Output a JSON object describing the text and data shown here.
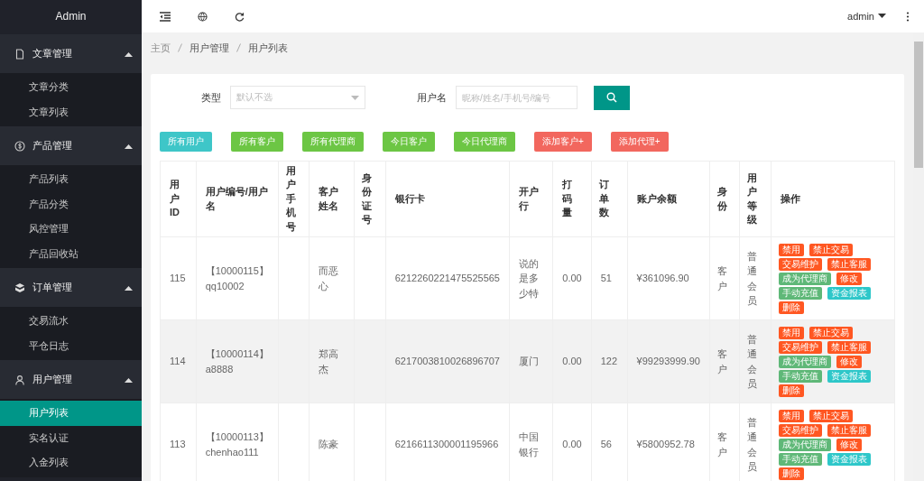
{
  "sidebar": {
    "title": "Admin",
    "groups": [
      {
        "label": "文章管理",
        "expanded": true,
        "items": [
          {
            "label": "文章分类",
            "selected": false
          },
          {
            "label": "文章列表",
            "selected": false
          }
        ]
      },
      {
        "label": "产品管理",
        "expanded": true,
        "items": [
          {
            "label": "产品列表",
            "selected": false
          },
          {
            "label": "产品分类",
            "selected": false
          },
          {
            "label": "风控管理",
            "selected": false
          },
          {
            "label": "产品回收站",
            "selected": false
          }
        ]
      },
      {
        "label": "订单管理",
        "expanded": true,
        "items": [
          {
            "label": "交易流水",
            "selected": false
          },
          {
            "label": "平仓日志",
            "selected": false
          }
        ]
      },
      {
        "label": "用户管理",
        "expanded": true,
        "items": [
          {
            "label": "用户列表",
            "selected": true
          },
          {
            "label": "实名认证",
            "selected": false
          },
          {
            "label": "入金列表",
            "selected": false
          }
        ]
      }
    ]
  },
  "header": {
    "user": "admin"
  },
  "breadcrumb": [
    "主页",
    "用户管理",
    "用户列表"
  ],
  "filters": {
    "type_label": "类型",
    "type_placeholder": "默认不选",
    "name_label": "用户名",
    "name_placeholder": "昵称/姓名/手机号/编号"
  },
  "quick_buttons": [
    {
      "label": "所有用户",
      "color": "#3ec6c8"
    },
    {
      "label": "所有客户",
      "color": "#6cc644"
    },
    {
      "label": "所有代理商",
      "color": "#6cc644"
    },
    {
      "label": "今日客户",
      "color": "#6cc644"
    },
    {
      "label": "今日代理商",
      "color": "#6cc644"
    },
    {
      "label": "添加客户+",
      "color": "#f2675e"
    },
    {
      "label": "添加代理+",
      "color": "#f2675e"
    }
  ],
  "table": {
    "columns": [
      "用户ID",
      "用户编号/用户名",
      "用户手机号",
      "客户姓名",
      "身份证号",
      "银行卡",
      "开户行",
      "打码量",
      "订单数",
      "账户余额",
      "身份",
      "用户等级",
      "操作"
    ],
    "rows": [
      {
        "id": "115",
        "code": "【10000115】",
        "username": "qq10002",
        "phone": "",
        "name": "而恶心",
        "id_number": "",
        "bank_card": "6212260221475525565",
        "bank": "说的是多少特",
        "betting": "0.00",
        "orders": "51",
        "balance": "¥361096.90",
        "role": "客户",
        "level": "普通会员",
        "highlighted": false,
        "actions": [
          {
            "label": "禁用",
            "color": "#ff5722"
          },
          {
            "label": "禁止交易",
            "color": "#ff5722"
          },
          {
            "label": "交易维护",
            "color": "#ff5722"
          },
          {
            "label": "禁止客服",
            "color": "#ff5722"
          },
          {
            "label": "成为代理商",
            "color": "#5fb878"
          },
          {
            "label": "修改",
            "color": "#ff5722"
          },
          {
            "label": "手动充值",
            "color": "#5fb878"
          },
          {
            "label": "资金报表",
            "color": "#2ec7c9"
          },
          {
            "label": "删除",
            "color": "#ff5722"
          }
        ]
      },
      {
        "id": "114",
        "code": "【10000114】",
        "username": "a8888",
        "phone": "",
        "name": "郑高杰",
        "id_number": "",
        "bank_card": "6217003810026896707",
        "bank": "厦门",
        "betting": "0.00",
        "orders": "122",
        "balance": "¥99293999.90",
        "role": "客户",
        "level": "普通会员",
        "highlighted": true,
        "actions": [
          {
            "label": "禁用",
            "color": "#ff5722"
          },
          {
            "label": "禁止交易",
            "color": "#ff5722"
          },
          {
            "label": "交易维护",
            "color": "#ff5722"
          },
          {
            "label": "禁止客服",
            "color": "#ff5722"
          },
          {
            "label": "成为代理商",
            "color": "#5fb878"
          },
          {
            "label": "修改",
            "color": "#ff5722"
          },
          {
            "label": "手动充值",
            "color": "#5fb878"
          },
          {
            "label": "资金报表",
            "color": "#2ec7c9"
          },
          {
            "label": "删除",
            "color": "#ff5722"
          }
        ]
      },
      {
        "id": "113",
        "code": "【10000113】",
        "username": "chenhao111",
        "phone": "",
        "name": "陈豪",
        "id_number": "",
        "bank_card": "6216611300001195966",
        "bank": "中国银行",
        "betting": "0.00",
        "orders": "56",
        "balance": "¥5800952.78",
        "role": "客户",
        "level": "普通会员",
        "highlighted": false,
        "actions": [
          {
            "label": "禁用",
            "color": "#ff5722"
          },
          {
            "label": "禁止交易",
            "color": "#ff5722"
          },
          {
            "label": "交易维护",
            "color": "#ff5722"
          },
          {
            "label": "禁止客服",
            "color": "#ff5722"
          },
          {
            "label": "成为代理商",
            "color": "#5fb878"
          },
          {
            "label": "修改",
            "color": "#ff5722"
          },
          {
            "label": "手动充值",
            "color": "#5fb878"
          },
          {
            "label": "资金报表",
            "color": "#2ec7c9"
          },
          {
            "label": "删除",
            "color": "#ff5722"
          }
        ]
      }
    ]
  }
}
